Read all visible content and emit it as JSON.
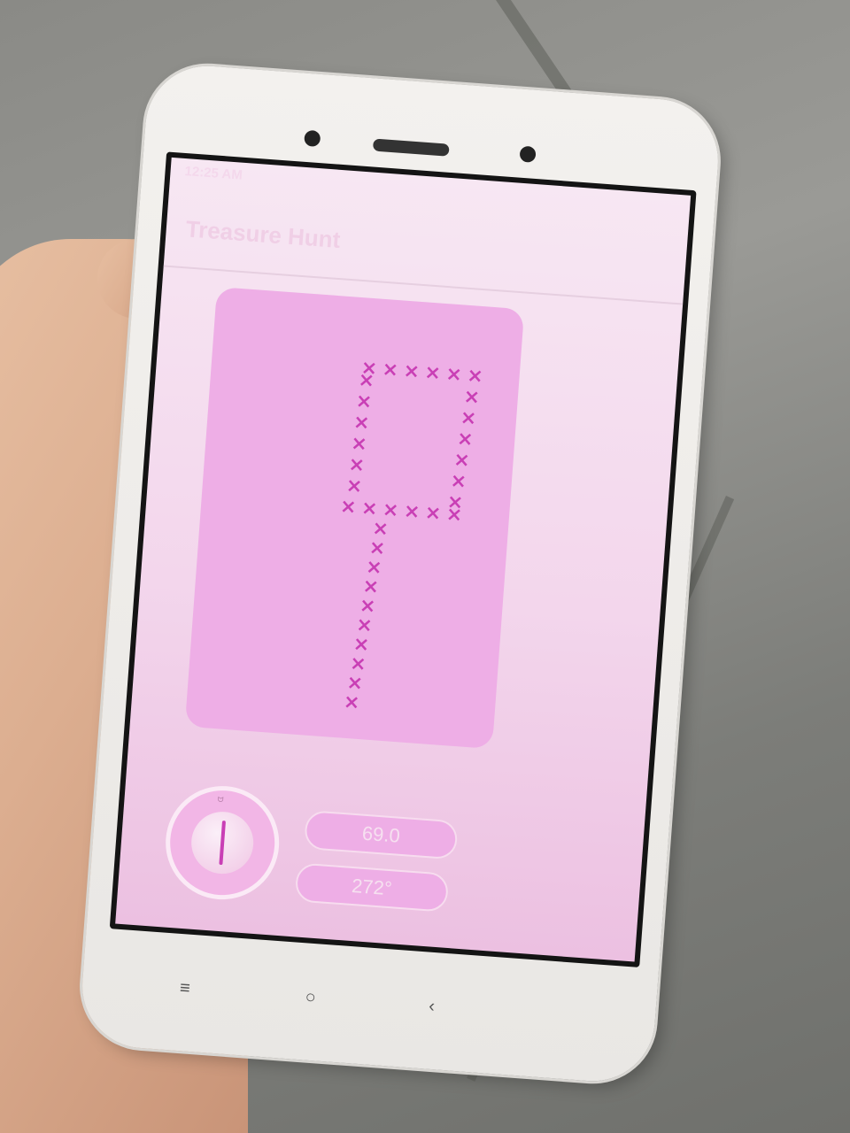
{
  "app": {
    "status_time": "12:25 AM",
    "title": "Treasure Hunt"
  },
  "readouts": {
    "distance": "69.0",
    "heading": "272°"
  },
  "map": {
    "marker": "×",
    "marker_color": "#c93fb5",
    "card_color": "#eeaee6"
  },
  "nav": {
    "menu": "≡",
    "home": "○",
    "back": "‹"
  },
  "icons": [
    "menu-icon",
    "home-icon",
    "back-icon",
    "compass-icon"
  ]
}
